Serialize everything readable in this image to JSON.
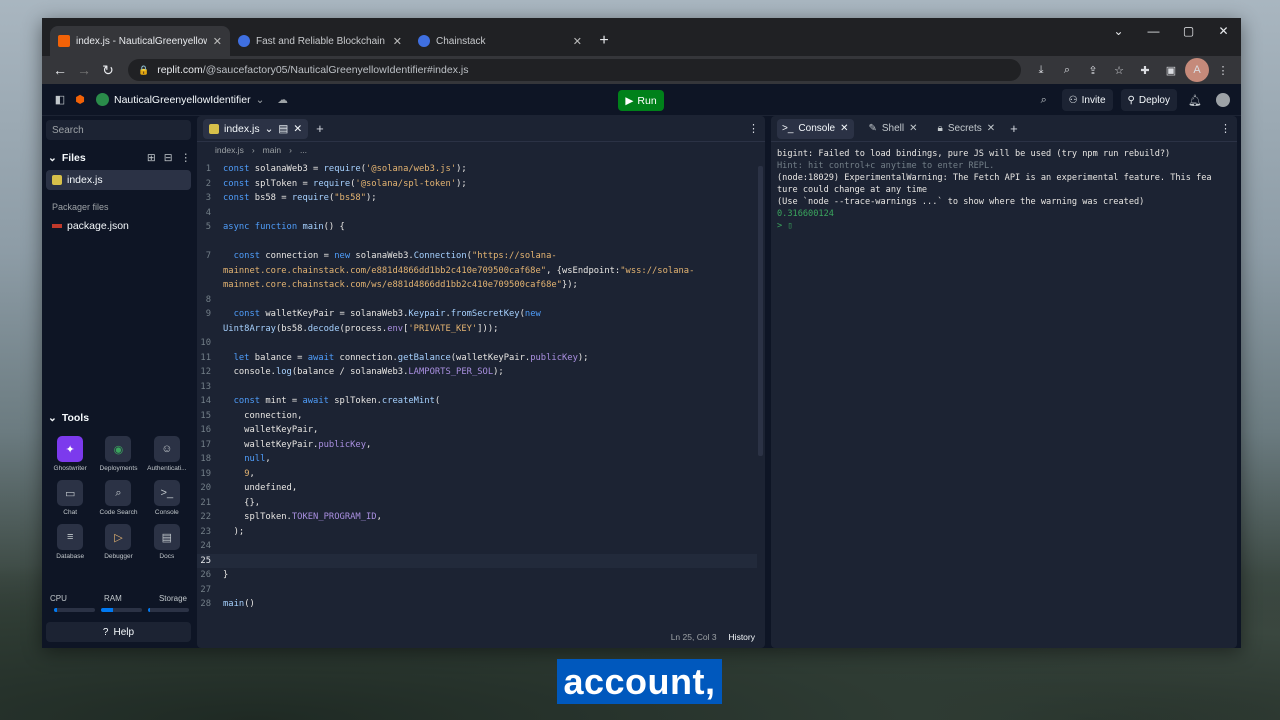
{
  "browser": {
    "tabs": [
      {
        "label": "index.js - NauticalGreenyellowIde",
        "active": true
      },
      {
        "label": "Fast and Reliable Blockchain Infra",
        "active": false
      },
      {
        "label": "Chainstack",
        "active": false
      }
    ],
    "url_host": "replit.com",
    "url_path": "/@saucefactory05/NauticalGreenyellowIdentifier#index.js",
    "avatar_letter": "A"
  },
  "header": {
    "repl_name": "NauticalGreenyellowIdentifier",
    "run_label": "Run",
    "invite_label": "Invite",
    "deploy_label": "Deploy"
  },
  "sidebar": {
    "search_placeholder": "Search",
    "files_title": "Files",
    "files": [
      {
        "name": "index.js",
        "active": true
      }
    ],
    "packager_label": "Packager files",
    "packager_files": [
      {
        "name": "package.json"
      }
    ],
    "tools_title": "Tools",
    "tools": [
      {
        "label": "Ghostwriter",
        "icon": "ghostwriter-icon",
        "glyph": "✦"
      },
      {
        "label": "Deployments",
        "icon": "deployments-icon",
        "glyph": "◉"
      },
      {
        "label": "Authenticati...",
        "icon": "user-icon",
        "glyph": "☺"
      },
      {
        "label": "Chat",
        "icon": "chat-icon",
        "glyph": "▭"
      },
      {
        "label": "Code Search",
        "icon": "search-icon",
        "glyph": "⌕"
      },
      {
        "label": "Console",
        "icon": "console-icon",
        "glyph": ">_"
      },
      {
        "label": "Database",
        "icon": "database-icon",
        "glyph": "≡"
      },
      {
        "label": "Debugger",
        "icon": "debugger-icon",
        "glyph": "▷"
      },
      {
        "label": "Docs",
        "icon": "docs-icon",
        "glyph": "▤"
      }
    ],
    "resources": {
      "cpu": "CPU",
      "ram": "RAM",
      "storage": "Storage"
    },
    "help_label": "Help"
  },
  "editor": {
    "tab_label": "index.js",
    "breadcrumb": [
      "index.js",
      "main",
      "..."
    ],
    "lines": [
      [
        [
          "k",
          "const "
        ],
        [
          "",
          "solanaWeb3 = "
        ],
        [
          "f",
          "require"
        ],
        [
          "",
          "("
        ],
        [
          "s",
          "'@solana/web3.js'"
        ],
        [
          "",
          ");"
        ]
      ],
      [
        [
          "k",
          "const "
        ],
        [
          "",
          "splToken = "
        ],
        [
          "f",
          "require"
        ],
        [
          "",
          "("
        ],
        [
          "s",
          "'@solana/spl-token'"
        ],
        [
          "",
          ");"
        ]
      ],
      [
        [
          "k",
          "const "
        ],
        [
          "",
          "bs58 = "
        ],
        [
          "f",
          "require"
        ],
        [
          "",
          "("
        ],
        [
          "s",
          "\"bs58\""
        ],
        [
          "",
          ");"
        ]
      ],
      [],
      [
        [
          "k",
          "async function "
        ],
        [
          "f",
          "main"
        ],
        [
          "",
          "() {"
        ]
      ],
      [],
      [
        [
          "",
          "  "
        ],
        [
          "k",
          "const "
        ],
        [
          "",
          "connection = "
        ],
        [
          "k",
          "new "
        ],
        [
          "",
          "solanaWeb3."
        ],
        [
          "f",
          "Connection"
        ],
        [
          "",
          "("
        ],
        [
          "s",
          "\"https://solana-"
        ]
      ],
      [
        [
          "s",
          "mainnet.core.chainstack.com/e881d4866dd1bb2c410e709500caf68e\""
        ],
        [
          "",
          ", {wsEndpoint:"
        ],
        [
          "s",
          "\"wss://solana-"
        ]
      ],
      [
        [
          "s",
          "mainnet.core.chainstack.com/ws/e881d4866dd1bb2c410e709500caf68e\""
        ],
        [
          "",
          "});"
        ]
      ],
      [],
      [
        [
          "",
          "  "
        ],
        [
          "k",
          "const "
        ],
        [
          "",
          "walletKeyPair = solanaWeb3."
        ],
        [
          "f",
          "Keypair"
        ],
        [
          "",
          "."
        ],
        [
          "f",
          "fromSecretKey"
        ],
        [
          "",
          "("
        ],
        [
          "k",
          "new"
        ]
      ],
      [
        [
          "f",
          "Uint8Array"
        ],
        [
          "",
          "(bs58."
        ],
        [
          "f",
          "decode"
        ],
        [
          "",
          "(process."
        ],
        [
          "p",
          "env"
        ],
        [
          "",
          "["
        ],
        [
          "s",
          "'PRIVATE_KEY'"
        ],
        [
          "",
          "]));"
        ]
      ],
      [],
      [
        [
          "",
          "  "
        ],
        [
          "k",
          "let "
        ],
        [
          "",
          "balance = "
        ],
        [
          "k",
          "await "
        ],
        [
          "",
          "connection."
        ],
        [
          "f",
          "getBalance"
        ],
        [
          "",
          "(walletKeyPair."
        ],
        [
          "p",
          "publicKey"
        ],
        [
          "",
          ");"
        ]
      ],
      [
        [
          "",
          "  console."
        ],
        [
          "f",
          "log"
        ],
        [
          "",
          "(balance / solanaWeb3."
        ],
        [
          "p",
          "LAMPORTS_PER_SOL"
        ],
        [
          "",
          ");"
        ]
      ],
      [],
      [
        [
          "",
          "  "
        ],
        [
          "k",
          "const "
        ],
        [
          "",
          "mint = "
        ],
        [
          "k",
          "await "
        ],
        [
          "",
          "splToken."
        ],
        [
          "f",
          "createMint"
        ],
        [
          "",
          "("
        ]
      ],
      [
        [
          "",
          "    connection,"
        ]
      ],
      [
        [
          "",
          "    walletKeyPair,"
        ]
      ],
      [
        [
          "",
          "    walletKeyPair."
        ],
        [
          "p",
          "publicKey"
        ],
        [
          "",
          ","
        ]
      ],
      [
        [
          "",
          "    "
        ],
        [
          "k",
          "null"
        ],
        [
          "",
          ","
        ]
      ],
      [
        [
          "",
          "    "
        ],
        [
          "s",
          "9"
        ],
        [
          "",
          ","
        ]
      ],
      [
        [
          "",
          "    undefined,"
        ]
      ],
      [
        [
          "",
          "    {},"
        ]
      ],
      [
        [
          "",
          "    splToken."
        ],
        [
          "p",
          "TOKEN_PROGRAM_ID"
        ],
        [
          "",
          ","
        ]
      ],
      [
        [
          "",
          "  );"
        ]
      ],
      [],
      [
        [
          "",
          "  "
        ]
      ],
      [
        [
          "",
          "}"
        ]
      ],
      [],
      [
        [
          "f",
          "main"
        ],
        [
          "",
          "()"
        ]
      ]
    ],
    "line_numbers": [
      "1",
      "2",
      "3",
      "4",
      "5",
      "",
      "7",
      "",
      "",
      "8",
      "9",
      "",
      "10",
      "11",
      "12",
      "13",
      "14",
      "15",
      "16",
      "17",
      "18",
      "19",
      "20",
      "21",
      "22",
      "23",
      "24",
      "25",
      "26",
      "27",
      "28"
    ],
    "cursor_line": "25",
    "status_pos": "Ln 25, Col 3",
    "history_label": "History"
  },
  "console": {
    "tabs": [
      {
        "label": "Console",
        "active": true
      },
      {
        "label": "Shell",
        "active": false
      },
      {
        "label": "Secrets",
        "active": false
      }
    ],
    "output": [
      {
        "text": "bigint: Failed to load bindings, pure JS will be used (try npm run rebuild?)",
        "cls": ""
      },
      {
        "text": "Hint: hit control+c anytime to enter REPL.",
        "cls": "dim"
      },
      {
        "text": "(node:18029) ExperimentalWarning: The Fetch API is an experimental feature. This fea",
        "cls": ""
      },
      {
        "text": "ture could change at any time",
        "cls": ""
      },
      {
        "text": "(Use `node --trace-warnings ...` to show where the warning was created)",
        "cls": ""
      },
      {
        "text": "0.316600124",
        "cls": "grn"
      },
      {
        "text": "> ▯",
        "cls": "grn"
      }
    ]
  },
  "caption": "account,"
}
